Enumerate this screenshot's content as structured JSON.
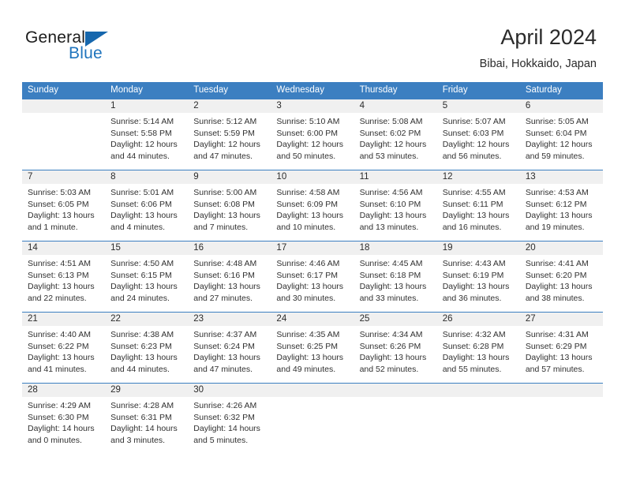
{
  "brand": {
    "name_part1": "General",
    "name_part2": "Blue",
    "accent_color": "#1667ad",
    "triangle_icon": "triangle-icon"
  },
  "header": {
    "title": "April 2024",
    "location": "Bibai, Hokkaido, Japan"
  },
  "calendar": {
    "header_bg": "#3c7fc1",
    "daynum_bg": "#f0f0f0",
    "weekdays": [
      "Sunday",
      "Monday",
      "Tuesday",
      "Wednesday",
      "Thursday",
      "Friday",
      "Saturday"
    ],
    "weeks": [
      [
        {
          "day": "",
          "sunrise": "",
          "sunset": "",
          "daylight_line1": "",
          "daylight_line2": ""
        },
        {
          "day": "1",
          "sunrise": "Sunrise: 5:14 AM",
          "sunset": "Sunset: 5:58 PM",
          "daylight_line1": "Daylight: 12 hours",
          "daylight_line2": "and 44 minutes."
        },
        {
          "day": "2",
          "sunrise": "Sunrise: 5:12 AM",
          "sunset": "Sunset: 5:59 PM",
          "daylight_line1": "Daylight: 12 hours",
          "daylight_line2": "and 47 minutes."
        },
        {
          "day": "3",
          "sunrise": "Sunrise: 5:10 AM",
          "sunset": "Sunset: 6:00 PM",
          "daylight_line1": "Daylight: 12 hours",
          "daylight_line2": "and 50 minutes."
        },
        {
          "day": "4",
          "sunrise": "Sunrise: 5:08 AM",
          "sunset": "Sunset: 6:02 PM",
          "daylight_line1": "Daylight: 12 hours",
          "daylight_line2": "and 53 minutes."
        },
        {
          "day": "5",
          "sunrise": "Sunrise: 5:07 AM",
          "sunset": "Sunset: 6:03 PM",
          "daylight_line1": "Daylight: 12 hours",
          "daylight_line2": "and 56 minutes."
        },
        {
          "day": "6",
          "sunrise": "Sunrise: 5:05 AM",
          "sunset": "Sunset: 6:04 PM",
          "daylight_line1": "Daylight: 12 hours",
          "daylight_line2": "and 59 minutes."
        }
      ],
      [
        {
          "day": "7",
          "sunrise": "Sunrise: 5:03 AM",
          "sunset": "Sunset: 6:05 PM",
          "daylight_line1": "Daylight: 13 hours",
          "daylight_line2": "and 1 minute."
        },
        {
          "day": "8",
          "sunrise": "Sunrise: 5:01 AM",
          "sunset": "Sunset: 6:06 PM",
          "daylight_line1": "Daylight: 13 hours",
          "daylight_line2": "and 4 minutes."
        },
        {
          "day": "9",
          "sunrise": "Sunrise: 5:00 AM",
          "sunset": "Sunset: 6:08 PM",
          "daylight_line1": "Daylight: 13 hours",
          "daylight_line2": "and 7 minutes."
        },
        {
          "day": "10",
          "sunrise": "Sunrise: 4:58 AM",
          "sunset": "Sunset: 6:09 PM",
          "daylight_line1": "Daylight: 13 hours",
          "daylight_line2": "and 10 minutes."
        },
        {
          "day": "11",
          "sunrise": "Sunrise: 4:56 AM",
          "sunset": "Sunset: 6:10 PM",
          "daylight_line1": "Daylight: 13 hours",
          "daylight_line2": "and 13 minutes."
        },
        {
          "day": "12",
          "sunrise": "Sunrise: 4:55 AM",
          "sunset": "Sunset: 6:11 PM",
          "daylight_line1": "Daylight: 13 hours",
          "daylight_line2": "and 16 minutes."
        },
        {
          "day": "13",
          "sunrise": "Sunrise: 4:53 AM",
          "sunset": "Sunset: 6:12 PM",
          "daylight_line1": "Daylight: 13 hours",
          "daylight_line2": "and 19 minutes."
        }
      ],
      [
        {
          "day": "14",
          "sunrise": "Sunrise: 4:51 AM",
          "sunset": "Sunset: 6:13 PM",
          "daylight_line1": "Daylight: 13 hours",
          "daylight_line2": "and 22 minutes."
        },
        {
          "day": "15",
          "sunrise": "Sunrise: 4:50 AM",
          "sunset": "Sunset: 6:15 PM",
          "daylight_line1": "Daylight: 13 hours",
          "daylight_line2": "and 24 minutes."
        },
        {
          "day": "16",
          "sunrise": "Sunrise: 4:48 AM",
          "sunset": "Sunset: 6:16 PM",
          "daylight_line1": "Daylight: 13 hours",
          "daylight_line2": "and 27 minutes."
        },
        {
          "day": "17",
          "sunrise": "Sunrise: 4:46 AM",
          "sunset": "Sunset: 6:17 PM",
          "daylight_line1": "Daylight: 13 hours",
          "daylight_line2": "and 30 minutes."
        },
        {
          "day": "18",
          "sunrise": "Sunrise: 4:45 AM",
          "sunset": "Sunset: 6:18 PM",
          "daylight_line1": "Daylight: 13 hours",
          "daylight_line2": "and 33 minutes."
        },
        {
          "day": "19",
          "sunrise": "Sunrise: 4:43 AM",
          "sunset": "Sunset: 6:19 PM",
          "daylight_line1": "Daylight: 13 hours",
          "daylight_line2": "and 36 minutes."
        },
        {
          "day": "20",
          "sunrise": "Sunrise: 4:41 AM",
          "sunset": "Sunset: 6:20 PM",
          "daylight_line1": "Daylight: 13 hours",
          "daylight_line2": "and 38 minutes."
        }
      ],
      [
        {
          "day": "21",
          "sunrise": "Sunrise: 4:40 AM",
          "sunset": "Sunset: 6:22 PM",
          "daylight_line1": "Daylight: 13 hours",
          "daylight_line2": "and 41 minutes."
        },
        {
          "day": "22",
          "sunrise": "Sunrise: 4:38 AM",
          "sunset": "Sunset: 6:23 PM",
          "daylight_line1": "Daylight: 13 hours",
          "daylight_line2": "and 44 minutes."
        },
        {
          "day": "23",
          "sunrise": "Sunrise: 4:37 AM",
          "sunset": "Sunset: 6:24 PM",
          "daylight_line1": "Daylight: 13 hours",
          "daylight_line2": "and 47 minutes."
        },
        {
          "day": "24",
          "sunrise": "Sunrise: 4:35 AM",
          "sunset": "Sunset: 6:25 PM",
          "daylight_line1": "Daylight: 13 hours",
          "daylight_line2": "and 49 minutes."
        },
        {
          "day": "25",
          "sunrise": "Sunrise: 4:34 AM",
          "sunset": "Sunset: 6:26 PM",
          "daylight_line1": "Daylight: 13 hours",
          "daylight_line2": "and 52 minutes."
        },
        {
          "day": "26",
          "sunrise": "Sunrise: 4:32 AM",
          "sunset": "Sunset: 6:28 PM",
          "daylight_line1": "Daylight: 13 hours",
          "daylight_line2": "and 55 minutes."
        },
        {
          "day": "27",
          "sunrise": "Sunrise: 4:31 AM",
          "sunset": "Sunset: 6:29 PM",
          "daylight_line1": "Daylight: 13 hours",
          "daylight_line2": "and 57 minutes."
        }
      ],
      [
        {
          "day": "28",
          "sunrise": "Sunrise: 4:29 AM",
          "sunset": "Sunset: 6:30 PM",
          "daylight_line1": "Daylight: 14 hours",
          "daylight_line2": "and 0 minutes."
        },
        {
          "day": "29",
          "sunrise": "Sunrise: 4:28 AM",
          "sunset": "Sunset: 6:31 PM",
          "daylight_line1": "Daylight: 14 hours",
          "daylight_line2": "and 3 minutes."
        },
        {
          "day": "30",
          "sunrise": "Sunrise: 4:26 AM",
          "sunset": "Sunset: 6:32 PM",
          "daylight_line1": "Daylight: 14 hours",
          "daylight_line2": "and 5 minutes."
        },
        {
          "day": "",
          "sunrise": "",
          "sunset": "",
          "daylight_line1": "",
          "daylight_line2": ""
        },
        {
          "day": "",
          "sunrise": "",
          "sunset": "",
          "daylight_line1": "",
          "daylight_line2": ""
        },
        {
          "day": "",
          "sunrise": "",
          "sunset": "",
          "daylight_line1": "",
          "daylight_line2": ""
        },
        {
          "day": "",
          "sunrise": "",
          "sunset": "",
          "daylight_line1": "",
          "daylight_line2": ""
        }
      ]
    ]
  }
}
